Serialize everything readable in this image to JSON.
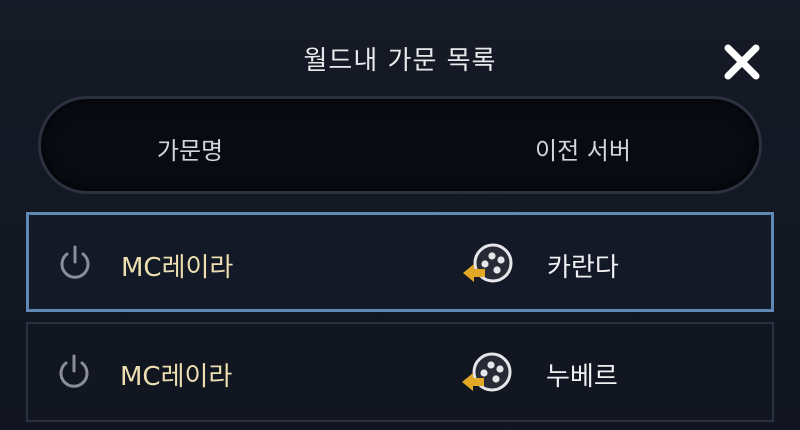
{
  "dialog": {
    "title": "월드내 가문 목록",
    "close_icon": "close-icon"
  },
  "columns": {
    "guild_name": "가문명",
    "previous_server": "이전 서버"
  },
  "rows": [
    {
      "guild_name": "MC레이라",
      "server": "카란다",
      "selected": true
    },
    {
      "guild_name": "MC레이라",
      "server": "누베르",
      "selected": false
    }
  ],
  "colors": {
    "guild_name_text": "#ecdfb0",
    "server_text": "#f0f0f2",
    "selected_border": "#5f89b4",
    "arrow_accent": "#e3a826"
  },
  "icons": {
    "row_power": "power-icon",
    "row_server_transfer": "server-transfer-icon"
  }
}
